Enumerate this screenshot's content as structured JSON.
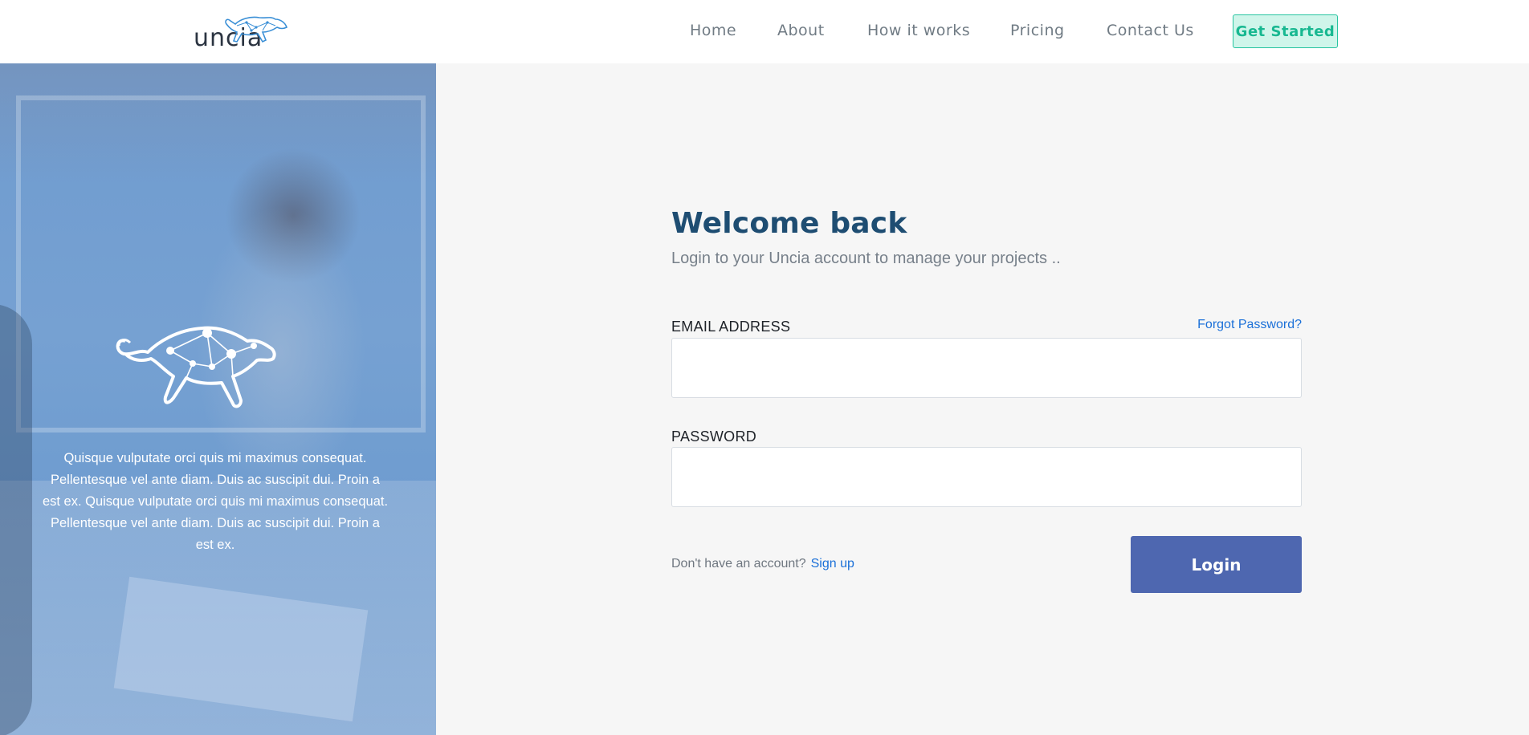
{
  "header": {
    "logo_text": "uncia",
    "nav": [
      {
        "label": "Home"
      },
      {
        "label": "About"
      },
      {
        "label": "How it works"
      },
      {
        "label": "Pricing"
      },
      {
        "label": "Contact Us"
      }
    ],
    "cta_label": "Get Started"
  },
  "hero": {
    "text": "Quisque vulputate orci quis mi maximus consequat. Pellentesque vel ante diam. Duis ac suscipit dui. Proin a est ex. Quisque vulputate orci quis mi maximus consequat. Pellentesque vel ante diam. Duis ac suscipit dui. Proin a est ex."
  },
  "form": {
    "title": "Welcome back",
    "subtitle": "Login to your Uncia account to manage your projects ..",
    "email_label": "EMAIL ADDRESS",
    "email_value": "",
    "forgot_label": "Forgot Password?",
    "password_label": "PASSWORD",
    "password_value": "",
    "signup_prompt": "Don't have an account?",
    "signup_link": "Sign up",
    "login_label": "Login"
  },
  "colors": {
    "brand_teal": "#18b891",
    "title_navy": "#1e4d72",
    "button_blue": "#4e67b0",
    "link_blue": "#1b70d8",
    "hero_overlay": "#6f9bcf"
  },
  "icons": {
    "logo": "snow-leopard-logo-icon",
    "hero": "snow-leopard-constellation-icon"
  }
}
